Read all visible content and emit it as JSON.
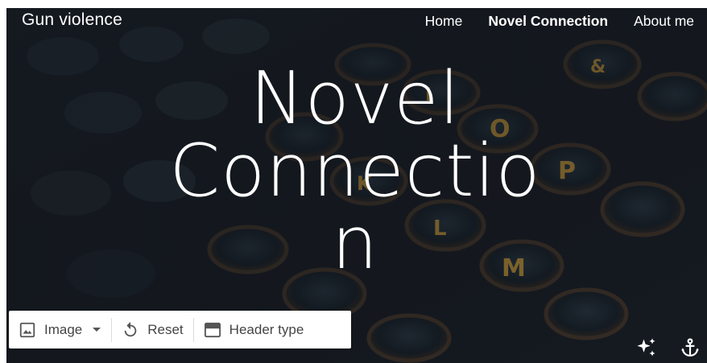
{
  "site": {
    "title": "Gun violence"
  },
  "nav": {
    "items": [
      {
        "label": "Home"
      },
      {
        "label": "Novel Connection"
      },
      {
        "label": "About me"
      }
    ]
  },
  "hero": {
    "title_lines": [
      "Novel",
      "Connectio",
      "n"
    ]
  },
  "toolbar": {
    "image_label": "Image",
    "reset_label": "Reset",
    "header_type_label": "Header type"
  },
  "icons": {
    "image": "image-icon",
    "dropdown": "dropdown-arrow-icon",
    "reset": "reset-icon",
    "header": "header-type-icon",
    "sparkle": "sparkle-icon",
    "anchor": "anchor-icon"
  }
}
